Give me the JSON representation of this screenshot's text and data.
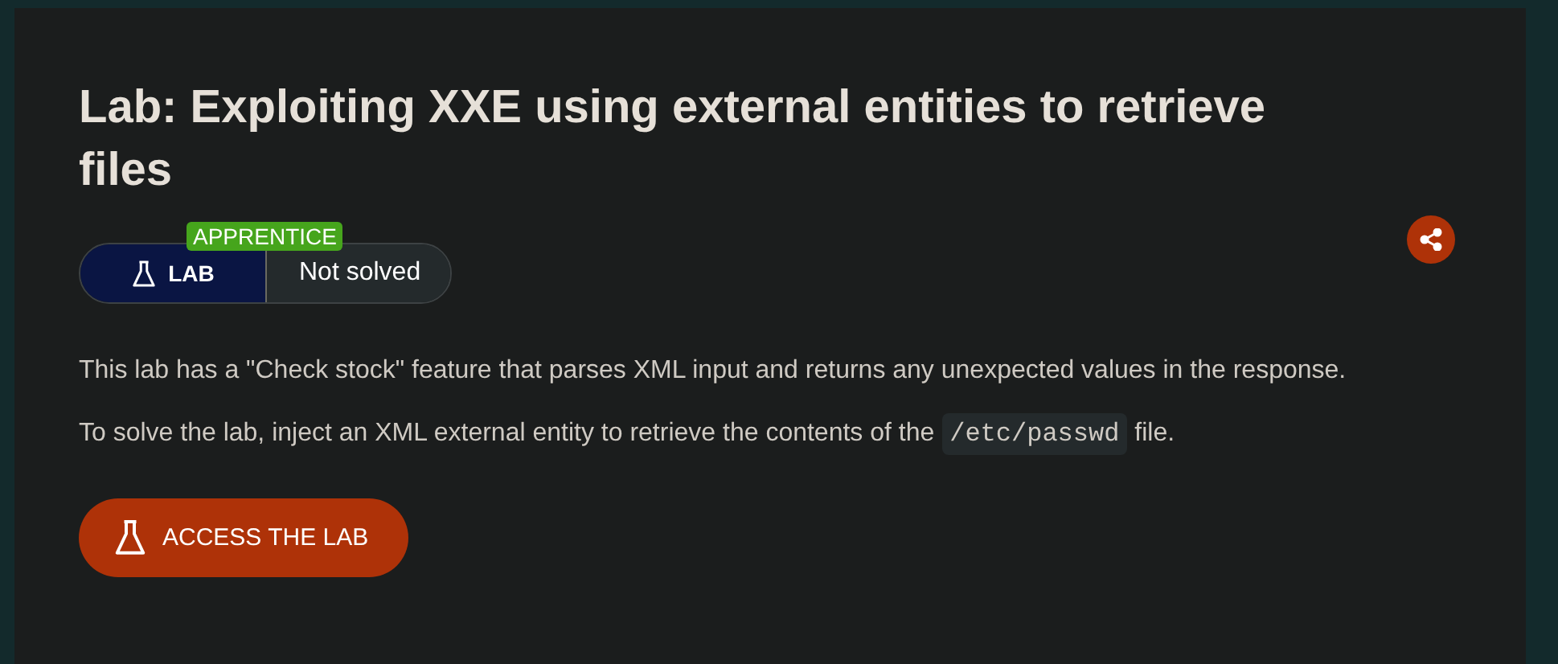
{
  "title": "Lab: Exploiting XXE using external entities to retrieve files",
  "lab_badge": {
    "level": "APPRENTICE",
    "type_label": "LAB",
    "status": "Not solved"
  },
  "description": [
    {
      "before": "This lab has a \"Check stock\" feature that parses XML input and returns any unexpected values in the response."
    },
    {
      "before": "To solve the lab, inject an XML external entity to retrieve the contents of the ",
      "code": "/etc/passwd",
      "after": " file."
    }
  ],
  "button": {
    "label": "ACCESS THE LAB"
  }
}
